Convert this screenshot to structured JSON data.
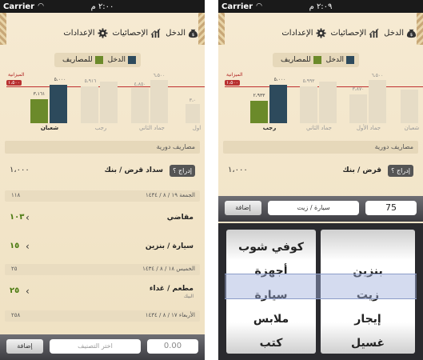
{
  "status": {
    "carrier": "Carrier",
    "left_time": "٢:٠٠ م",
    "right_time": "٢:٠٩ م"
  },
  "tabs": {
    "income": "الدخل",
    "stats": "الإحصائيات",
    "settings": "الإعدادات"
  },
  "legend": {
    "income": "الدخل",
    "expenses": "للمصاريف"
  },
  "colors": {
    "income": "#2d4a5c",
    "expenses": "#6b8a2a",
    "faded": "#e3d9c6",
    "budget": "#b83030"
  },
  "left": {
    "budget_label": "الميزانية",
    "budget_value": "١،٥٠٠",
    "chart_data": {
      "type": "bar",
      "categories": [
        "شعبان",
        "رجب",
        "جماد الثاني",
        "اول"
      ],
      "series": [
        {
          "name": "الدخل",
          "values": [
            5000,
            5916,
            6500,
            3000
          ]
        },
        {
          "name": "للمصاريف",
          "values": [
            3161,
            5100,
            4850,
            1500
          ]
        }
      ],
      "value_labels": [
        "٥،٠٠٠",
        "٣،١٦١",
        "٥،٩١٦",
        "٦،٥٠٠",
        "٤،٨٥٠",
        "٣،٠"
      ],
      "ylim": [
        0,
        7000
      ]
    },
    "section": "مصاريف دورية",
    "recurring": {
      "insert": "إدراج ؟",
      "title": "سداد قرض / بنك",
      "amount": "١،٠٠٠"
    },
    "days": [
      {
        "date": "الجمعة  ١٩ / ٨ / ١٤٣٤",
        "total": "١١٨"
      },
      {
        "date": "الخميس  ١٨ / ٨ / ١٤٣٤",
        "total": "٢٥"
      },
      {
        "date": "الأربعاء  ١٧ / ٨ / ١٤٣٤",
        "total": "٢٥٨"
      }
    ],
    "items": [
      {
        "title": "مقاضي",
        "amount": "١٠٣"
      },
      {
        "title": "سيارة / بنزين",
        "amount": "١٥"
      },
      {
        "title": "مطعم / غداء",
        "sub": "البيك",
        "amount": "٢٥"
      }
    ],
    "bottom": {
      "add": "إضافة",
      "category_placeholder": "اختر التصنيف",
      "amount": "0.00"
    }
  },
  "right": {
    "budget_label": "الميزانية",
    "budget_value": "١،٥٠٠",
    "chart_data": {
      "type": "bar",
      "categories": [
        "رجب",
        "جماد الثاني",
        "جماد الأول",
        "شعبان"
      ],
      "series": [
        {
          "name": "الدخل",
          "values": [
            5000,
            5993,
            6500,
            6500
          ]
        },
        {
          "name": "للمصاريف",
          "values": [
            2933,
            5100,
            3870,
            4050
          ]
        }
      ],
      "value_labels": [
        "٥،٠٠٠",
        "٢،٩٣٣",
        "٥،٩٩٣",
        "٣،٨٧٠",
        "٦،٥٠٠"
      ],
      "ylim": [
        0,
        7000
      ]
    },
    "section": "مصاريف دورية",
    "recurring": {
      "insert": "إدراج ؟",
      "title": "قرض / بنك",
      "amount": "١،٠٠٠"
    },
    "bottom": {
      "add": "إضافة",
      "category_value": "سيارة / زيت",
      "amount": "75"
    },
    "picker_left": [
      "كوفي شوب",
      "أجهزة",
      "سيارة",
      "ملابس",
      "كتب"
    ],
    "picker_right": [
      "",
      "بنزين",
      "زيت",
      "إيجار",
      "غسيل"
    ]
  }
}
